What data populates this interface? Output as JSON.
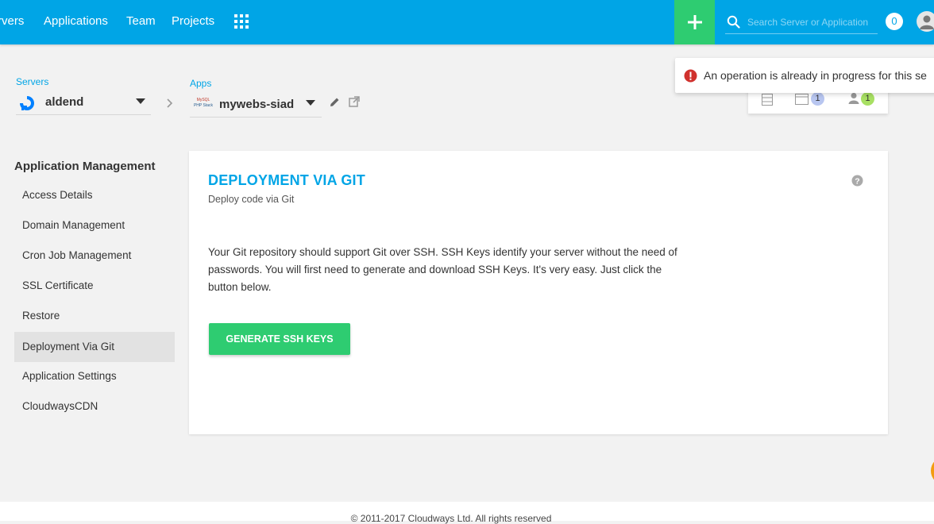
{
  "nav": {
    "items": [
      {
        "label": "rvers"
      },
      {
        "label": "Applications"
      },
      {
        "label": "Team"
      },
      {
        "label": "Projects"
      }
    ],
    "search_placeholder": "Search Server or Application",
    "notifications_count": "0"
  },
  "breadcrumb": {
    "servers_label": "Servers",
    "server_name": "aldend",
    "apps_label": "Apps",
    "app_name": "mywebs-siad",
    "app_logo_text_1": "MySQL",
    "app_logo_text_2": "PHP Stack"
  },
  "toast": {
    "message": "An operation is already in progress for this se"
  },
  "status_panel": {
    "apps_count": "1",
    "team_count": "1"
  },
  "sidebar": {
    "title": "Application Management",
    "items": [
      {
        "label": "Access Details"
      },
      {
        "label": "Domain Management"
      },
      {
        "label": "Cron Job Management"
      },
      {
        "label": "SSL Certificate"
      },
      {
        "label": "Restore"
      },
      {
        "label": "Deployment Via Git",
        "active": true
      },
      {
        "label": "Application Settings"
      },
      {
        "label": "CloudwaysCDN"
      }
    ]
  },
  "main": {
    "title": "DEPLOYMENT VIA GIT",
    "subtitle": "Deploy code via Git",
    "description": "Your Git repository should support Git over SSH. SSH Keys identify your server without the need of passwords. You will first need to generate and download SSH Keys. It's very easy. Just click the button below.",
    "button_label": "GENERATE SSH KEYS"
  },
  "footer": {
    "text": "© 2011-2017 Cloudways Ltd. All rights reserved"
  },
  "colors": {
    "brand_blue": "#00a5e6",
    "accent_green": "#2ecc71",
    "error_red": "#d0312d"
  },
  "icons": [
    "apps-grid-icon",
    "plus-icon",
    "search-icon",
    "user-avatar-icon",
    "digitalocean-icon",
    "chevron-right-icon",
    "edit-pencil-icon",
    "external-link-icon",
    "error-icon",
    "server-list-icon",
    "window-icon",
    "team-icon",
    "help-icon"
  ]
}
